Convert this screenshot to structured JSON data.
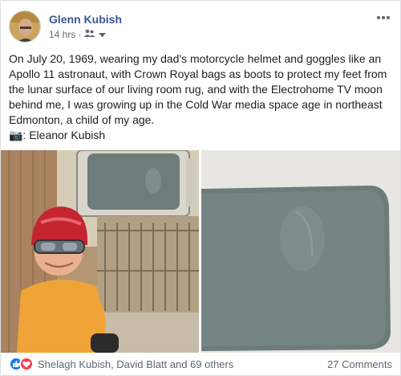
{
  "post": {
    "author": "Glenn Kubish",
    "time": "14 hrs",
    "separator": "·",
    "audience_icon": "friends-icon",
    "paragraphs": [
      "On July 20, 1969, wearing my dad's motorcycle helmet and goggles like an Apollo 11 astronaut, with Crown Royal bags as boots to protect my feet from the lunar surface of our living room rug, and with the Electrohome TV moon behind me, I was growing up in the Cold War media space age in northeast Edmonton, a child of my age.",
      "📷: Eleanor Kubish"
    ]
  },
  "footer": {
    "reactions": [
      "like",
      "love"
    ],
    "reactors": "Shelagh Kubish, David Blatt and 69 others",
    "comments": "27 Comments"
  },
  "colors": {
    "author": "#385898",
    "like": "#1877f2",
    "love": "#f33e58"
  }
}
